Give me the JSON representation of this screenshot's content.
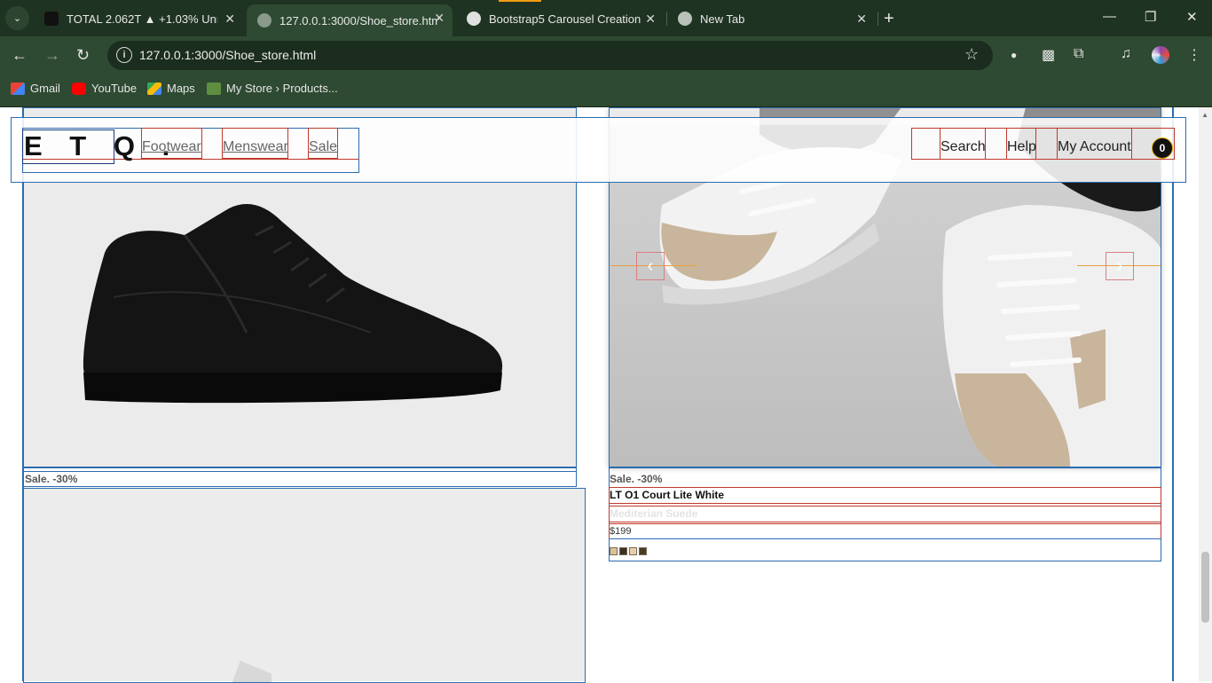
{
  "browser": {
    "tabs": [
      {
        "title": "TOTAL 2.062T ▲ +1.03% Unnam",
        "active": false
      },
      {
        "title": "127.0.0.1:3000/Shoe_store.html",
        "active": true
      },
      {
        "title": "Bootstrap5 Carousel Creation",
        "active": false
      },
      {
        "title": "New Tab",
        "active": false
      }
    ],
    "url": "127.0.0.1:3000/Shoe_store.html",
    "bookmarks": [
      "Gmail",
      "YouTube",
      "Maps",
      "My Store › Products..."
    ],
    "colors": {
      "frame": "#1f3322",
      "toolbar": "#2e4a32"
    }
  },
  "header": {
    "logo": "E T Q .",
    "nav": [
      "Footwear",
      "Menswear",
      "Sale"
    ],
    "right": [
      "Search",
      "Help",
      "My Account"
    ],
    "cart_count": "0"
  },
  "products": {
    "left": {
      "sale_label": "Sale. -30%"
    },
    "right": {
      "sale_label": "Sale. -30%",
      "name": "LT O1 Court Lite White",
      "variant": "Mediterian Suede",
      "price": "$199",
      "swatch_colors": [
        "#d9c29a",
        "#3a2f20",
        "#e6d0a8",
        "#4a3a22"
      ]
    }
  },
  "carousel": {
    "prev_label": "‹",
    "next_label": "›"
  }
}
